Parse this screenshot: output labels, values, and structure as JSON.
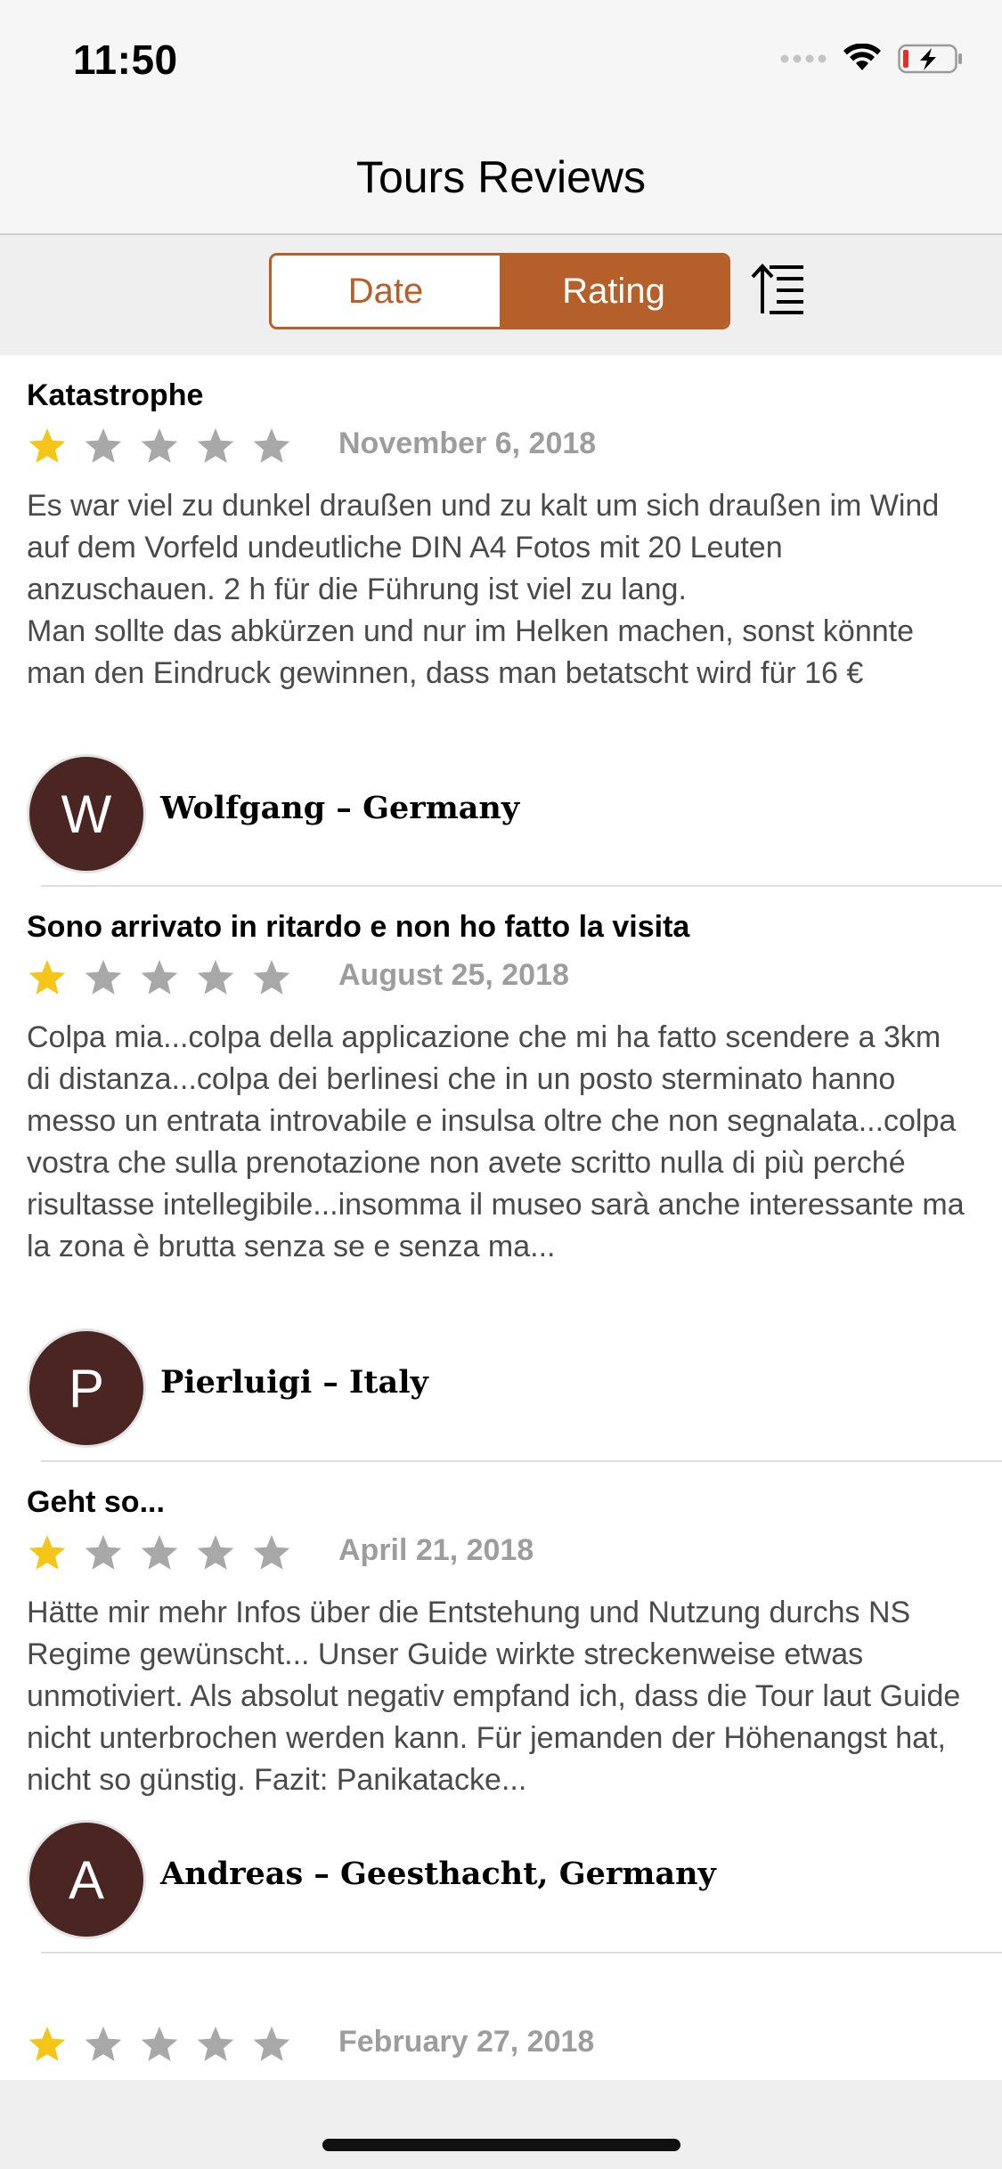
{
  "status_bar": {
    "time": "11:50"
  },
  "nav": {
    "title": "Tours Reviews"
  },
  "segment": {
    "options": [
      "Date",
      "Rating"
    ],
    "selected": "Rating",
    "sort_icon": "sort-ascending-icon"
  },
  "reviews": [
    {
      "title": "Katastrophe",
      "rating": 1,
      "max_rating": 5,
      "date": "November 6, 2018",
      "body": "Es war viel zu dunkel draußen und zu kalt um sich draußen im Wind auf dem Vorfeld undeutliche DIN A4 Fotos mit 20 Leuten anzuschauen. 2 h für die Führung ist viel zu lang.\nMan sollte das abkürzen und nur im Helken machen, sonst könnte man den Eindruck gewinnen, dass man betatscht wird für 16 €",
      "initial": "W",
      "author": "Wolfgang – Germany"
    },
    {
      "title": "Sono arrivato in ritardo e non ho fatto la visita",
      "rating": 1,
      "max_rating": 5,
      "date": "August 25, 2018",
      "body": "Colpa mia...colpa della applicazione che mi ha fatto scendere a 3km di distanza...colpa dei berlinesi che in un posto sterminato hanno messo un entrata introvabile e insulsa oltre che non segnalata...colpa vostra che sulla prenotazione non avete scritto nulla di più perché risultasse intellegibile...insomma il museo sarà anche interessante ma la zona è brutta senza se e senza ma...",
      "initial": "P",
      "author": "Pierluigi – Italy"
    },
    {
      "title": "Geht so...",
      "rating": 1,
      "max_rating": 5,
      "date": "April 21, 2018",
      "body": "Hätte mir mehr Infos über die Entstehung und Nutzung durchs NS Regime gewünscht... Unser Guide wirkte streckenweise etwas unmotiviert. Als absolut negativ empfand ich, dass die Tour laut Guide nicht unterbrochen werden kann. Für jemanden der Höhenangst hat, nicht so günstig. Fazit: Panikatacke...",
      "initial": "A",
      "author": "Andreas – Geesthacht, Germany"
    },
    {
      "title": "",
      "rating": 1,
      "max_rating": 5,
      "date": "February 27, 2018",
      "body": "",
      "initial": "",
      "author": ""
    }
  ],
  "colors": {
    "accent": "#b5602b",
    "avatar_bg": "#4a2521",
    "star_filled": "#f5c518",
    "star_empty": "#a8a8a8",
    "date_text": "#9d9d9d",
    "body_text": "#4a4a4a"
  }
}
